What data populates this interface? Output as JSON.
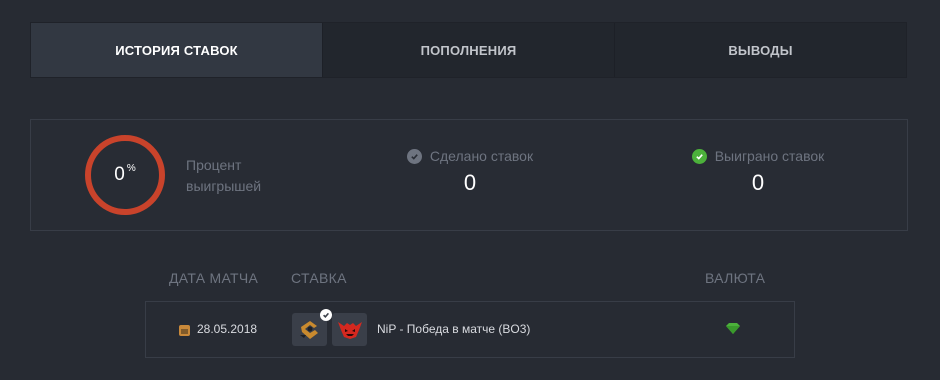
{
  "tabs": [
    {
      "label": "ИСТОРИЯ СТАВОК",
      "active": true
    },
    {
      "label": "ПОПОЛНЕНИЯ",
      "active": false
    },
    {
      "label": "ВЫВОДЫ",
      "active": false
    }
  ],
  "stats": {
    "winrate": {
      "value": "0",
      "unit": "%",
      "label_line1": "Процент",
      "label_line2": "выигрышей"
    },
    "bets_made": {
      "label": "Сделано ставок",
      "value": "0",
      "icon": "check-circle-gray-icon"
    },
    "bets_won": {
      "label": "Выиграно ставок",
      "value": "0",
      "icon": "check-circle-green-icon"
    }
  },
  "table": {
    "headers": {
      "date": "ДАТА МАТЧА",
      "bet": "СТАВКА",
      "currency": "ВАЛЮТА"
    },
    "rows": [
      {
        "date": "28.05.2018",
        "team1_icon": "nip-logo-icon",
        "team2_icon": "hellraisers-logo-icon",
        "bet": "NiP - Победа в матче (BO3)",
        "currency_icon": "green-gem-icon"
      }
    ]
  },
  "colors": {
    "background": "#272b33",
    "ring": "#c9432b",
    "accent_green": "#4cb13b",
    "muted_text": "#6e7480"
  }
}
